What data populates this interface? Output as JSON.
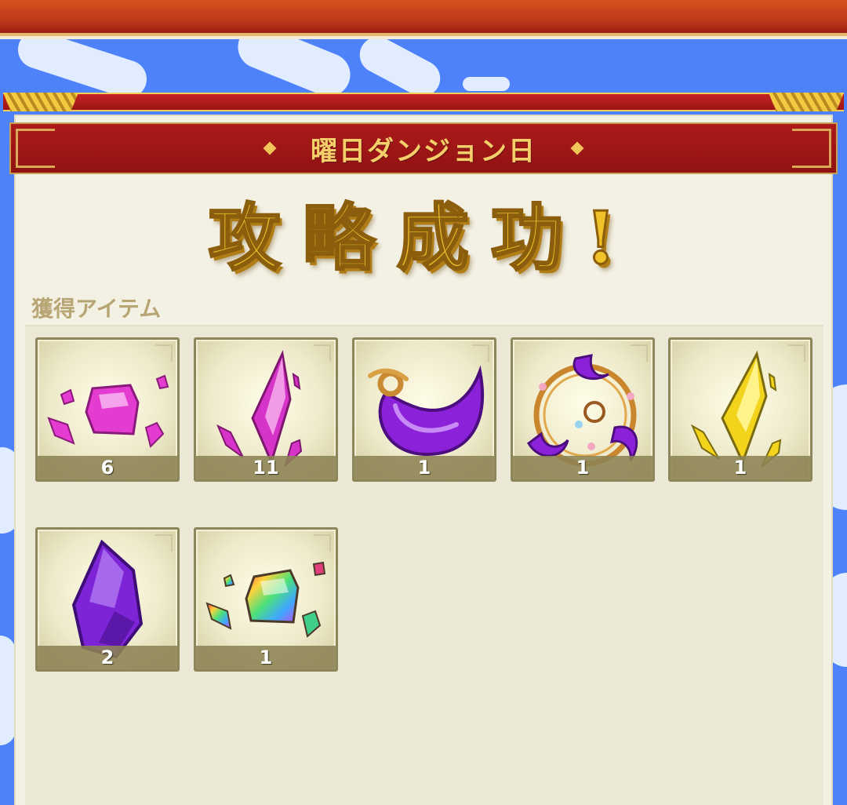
{
  "header": {
    "title": "曜日ダンジョン日",
    "result": "攻略成功!"
  },
  "rewards": {
    "section_label": "獲得アイテム",
    "items": [
      {
        "icon": "pink-crystal-fragments-icon",
        "count": "6"
      },
      {
        "icon": "pink-crystal-shard-icon",
        "count": "11"
      },
      {
        "icon": "purple-magatama-icon",
        "count": "1"
      },
      {
        "icon": "magatama-ring-charm-icon",
        "count": "1"
      },
      {
        "icon": "yellow-crystal-shard-icon",
        "count": "1"
      },
      {
        "icon": "purple-crystal-icon",
        "count": "2"
      },
      {
        "icon": "rainbow-crystal-fragments-icon",
        "count": "1"
      }
    ]
  },
  "colors": {
    "banner_red": "#a3161a",
    "gold_text": "#f4cf6a",
    "sky_blue": "#4d82fb",
    "panel_bg": "#f3f0e4"
  }
}
